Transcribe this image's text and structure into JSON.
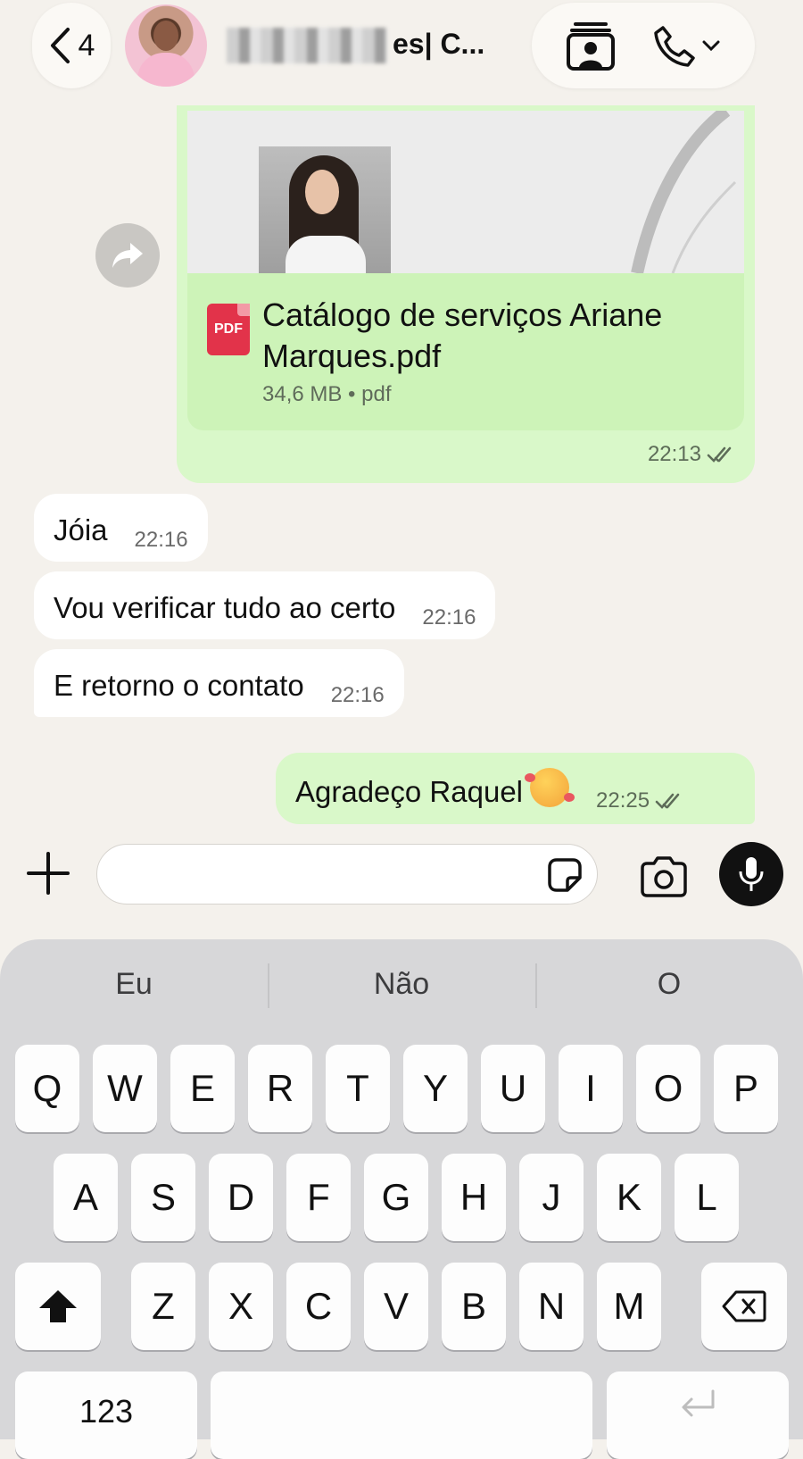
{
  "header": {
    "back_count": "4",
    "contact_name_visible": "es| C..."
  },
  "messages": {
    "document": {
      "file_name": "Catálogo de serviços Ariane Marques.pdf",
      "meta": "34,6 MB • pdf",
      "icon_label": "PDF",
      "time": "22:13"
    },
    "incoming": [
      {
        "text": "Jóia",
        "time": "22:16"
      },
      {
        "text": "Vou verificar tudo ao certo",
        "time": "22:16"
      },
      {
        "text": "E retorno o contato",
        "time": "22:16"
      }
    ],
    "outgoing_last": {
      "text": "Agradeço Raquel",
      "time": "22:25"
    }
  },
  "composer": {
    "value": "",
    "placeholder": ""
  },
  "keyboard": {
    "suggestions": [
      "Eu",
      "Não",
      "O"
    ],
    "row1": [
      "Q",
      "W",
      "E",
      "R",
      "T",
      "Y",
      "U",
      "I",
      "O",
      "P"
    ],
    "row2": [
      "A",
      "S",
      "D",
      "F",
      "G",
      "H",
      "J",
      "K",
      "L"
    ],
    "row3": [
      "Z",
      "X",
      "C",
      "V",
      "B",
      "N",
      "M"
    ],
    "numbers_key": "123"
  },
  "colors": {
    "chat_bg": "#f4f1ec",
    "outgoing_bubble": "#d9f8c9",
    "incoming_bubble": "#ffffff",
    "keyboard_bg": "#d7d7d9"
  }
}
